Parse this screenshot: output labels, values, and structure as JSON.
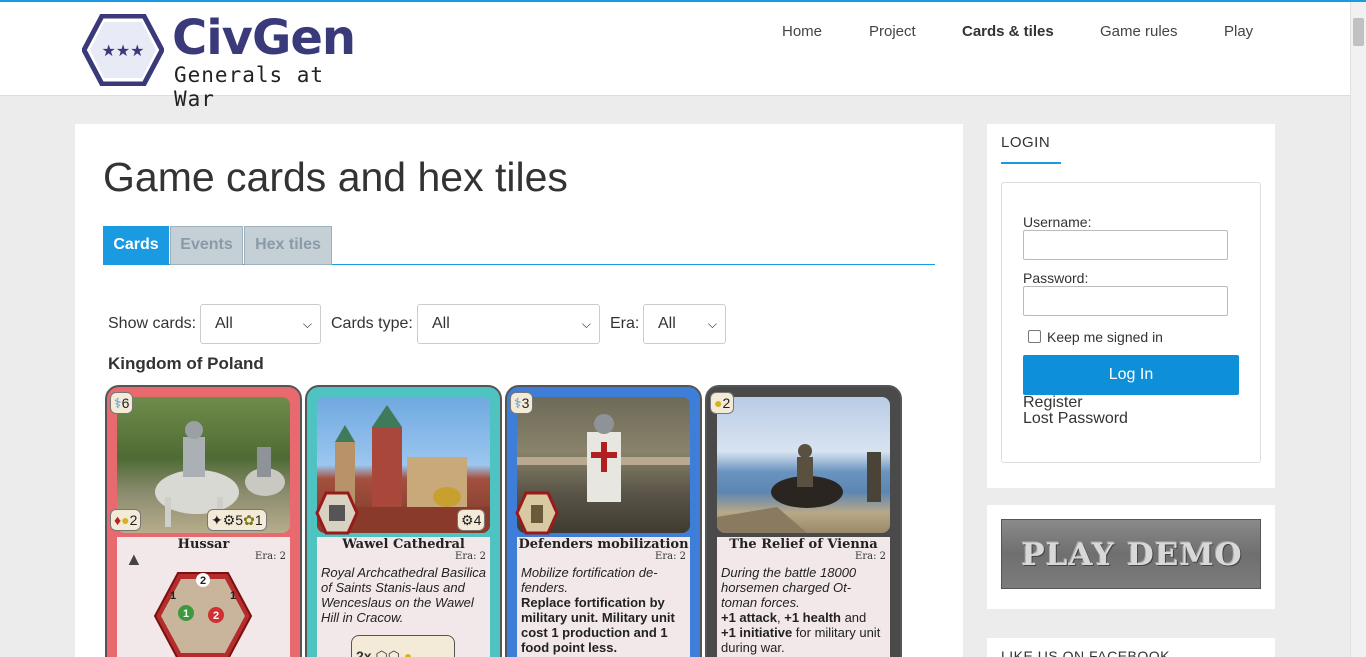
{
  "logo": {
    "title": "CivGen",
    "subtitle": "Generals at War"
  },
  "nav": [
    {
      "label": "Home",
      "active": false
    },
    {
      "label": "Project",
      "active": false
    },
    {
      "label": "Cards & tiles",
      "active": true
    },
    {
      "label": "Game rules",
      "active": false
    },
    {
      "label": "Play",
      "active": false
    }
  ],
  "page": {
    "title": "Game cards and hex tiles"
  },
  "tabs": [
    {
      "label": "Cards",
      "active": true
    },
    {
      "label": "Events",
      "active": false
    },
    {
      "label": "Hex tiles",
      "active": false
    }
  ],
  "filters": {
    "show_label": "Show cards:",
    "show_value": "All",
    "type_label": "Cards type:",
    "type_value": "All",
    "era_label": "Era:",
    "era_value": "All"
  },
  "section": {
    "title": "Kingdom of Poland"
  },
  "cards": [
    {
      "name": "Hussar",
      "era": "Era: 2",
      "cost": "6",
      "cost_icon": "science-flask-icon",
      "stat_left": "2",
      "stat_mid": "5",
      "stat_right": "1",
      "color": "#e86a6e"
    },
    {
      "name": "Wawel Cathedral",
      "era": "Era: 2",
      "text": "Royal Archcathedral Basilica of Saints Stanis-laus and Wenceslaus on the Wawel Hill in Cracow.",
      "stat_right": "4",
      "extra": "2x",
      "color": "#4fc3c2"
    },
    {
      "name": "Defenders mobilization",
      "era": "Era: 2",
      "cost": "3",
      "cost_icon": "science-flask-icon",
      "text_italic": "Mobilize fortification de-fenders.",
      "text_bold": "Replace fortification by military unit. Military unit cost 1 production and 1 food point less.",
      "color": "#3f7ed8"
    },
    {
      "name": "The Relief of Vienna",
      "era": "Era: 2",
      "cost": "2",
      "cost_icon": "gold-coin-icon",
      "text_italic": "During the battle 18000 horsemen charged Ot-toman forces.",
      "text_b1": "+1 attack",
      "text_s1": ", ",
      "text_b2": "+1 health",
      "text_s2": " and ",
      "text_b3": "+1 initiative",
      "text_s3": " for military unit during war.",
      "color": "#4a4a4a"
    }
  ],
  "unit_hex": {
    "top": "2",
    "left": "1",
    "right": "1",
    "green": "1",
    "red": "2"
  },
  "sidebar": {
    "login_title": "LOGIN",
    "username_label": "Username:",
    "password_label": "Password:",
    "remember_label": "Keep me signed in",
    "login_button": "Log In",
    "register_link": "Register",
    "lost_password_link": "Lost Password",
    "demo_label": "PLAY DEMO",
    "facebook_title": "LIKE US ON FACEBOOK"
  }
}
